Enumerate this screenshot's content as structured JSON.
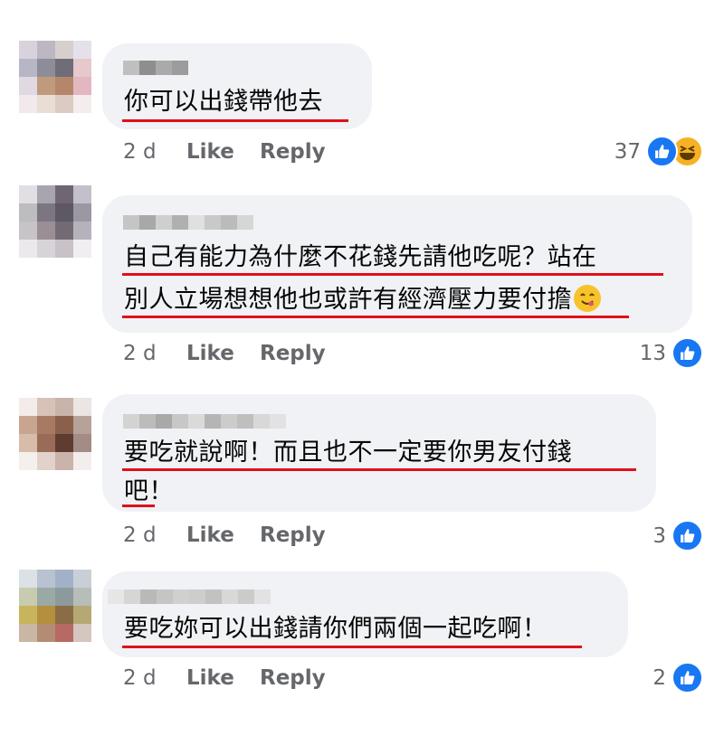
{
  "comments": [
    {
      "lines": [
        "你可以出錢帶他去"
      ],
      "time": "2 d",
      "like_label": "Like",
      "reply_label": "Reply",
      "reaction_count": "37",
      "reaction_icons": [
        "like-icon",
        "haha-icon"
      ]
    },
    {
      "lines": [
        "自己有能力為什麼不花錢先請他吃呢？站在",
        "別人立場想想他也或許有經濟壓力要付擔"
      ],
      "trailing_emoji": "yum-face-icon",
      "time": "2 d",
      "like_label": "Like",
      "reply_label": "Reply",
      "reaction_count": "13",
      "reaction_icons": [
        "like-icon"
      ]
    },
    {
      "lines": [
        "要吃就說啊！而且也不一定要你男友付錢",
        "吧！"
      ],
      "time": "2 d",
      "like_label": "Like",
      "reply_label": "Reply",
      "reaction_count": "3",
      "reaction_icons": [
        "like-icon"
      ]
    },
    {
      "lines": [
        "要吃妳可以出錢請你們兩個一起吃啊！"
      ],
      "time": "2 d",
      "like_label": "Like",
      "reply_label": "Reply",
      "reaction_count": "2",
      "reaction_icons": [
        "like-icon"
      ]
    }
  ],
  "colors": {
    "bubble": "#f0f2f5",
    "meta_text": "#65676b",
    "underline": "#e0101a",
    "like_blue": "#1877f2",
    "haha_yellow": "#f7b125"
  }
}
